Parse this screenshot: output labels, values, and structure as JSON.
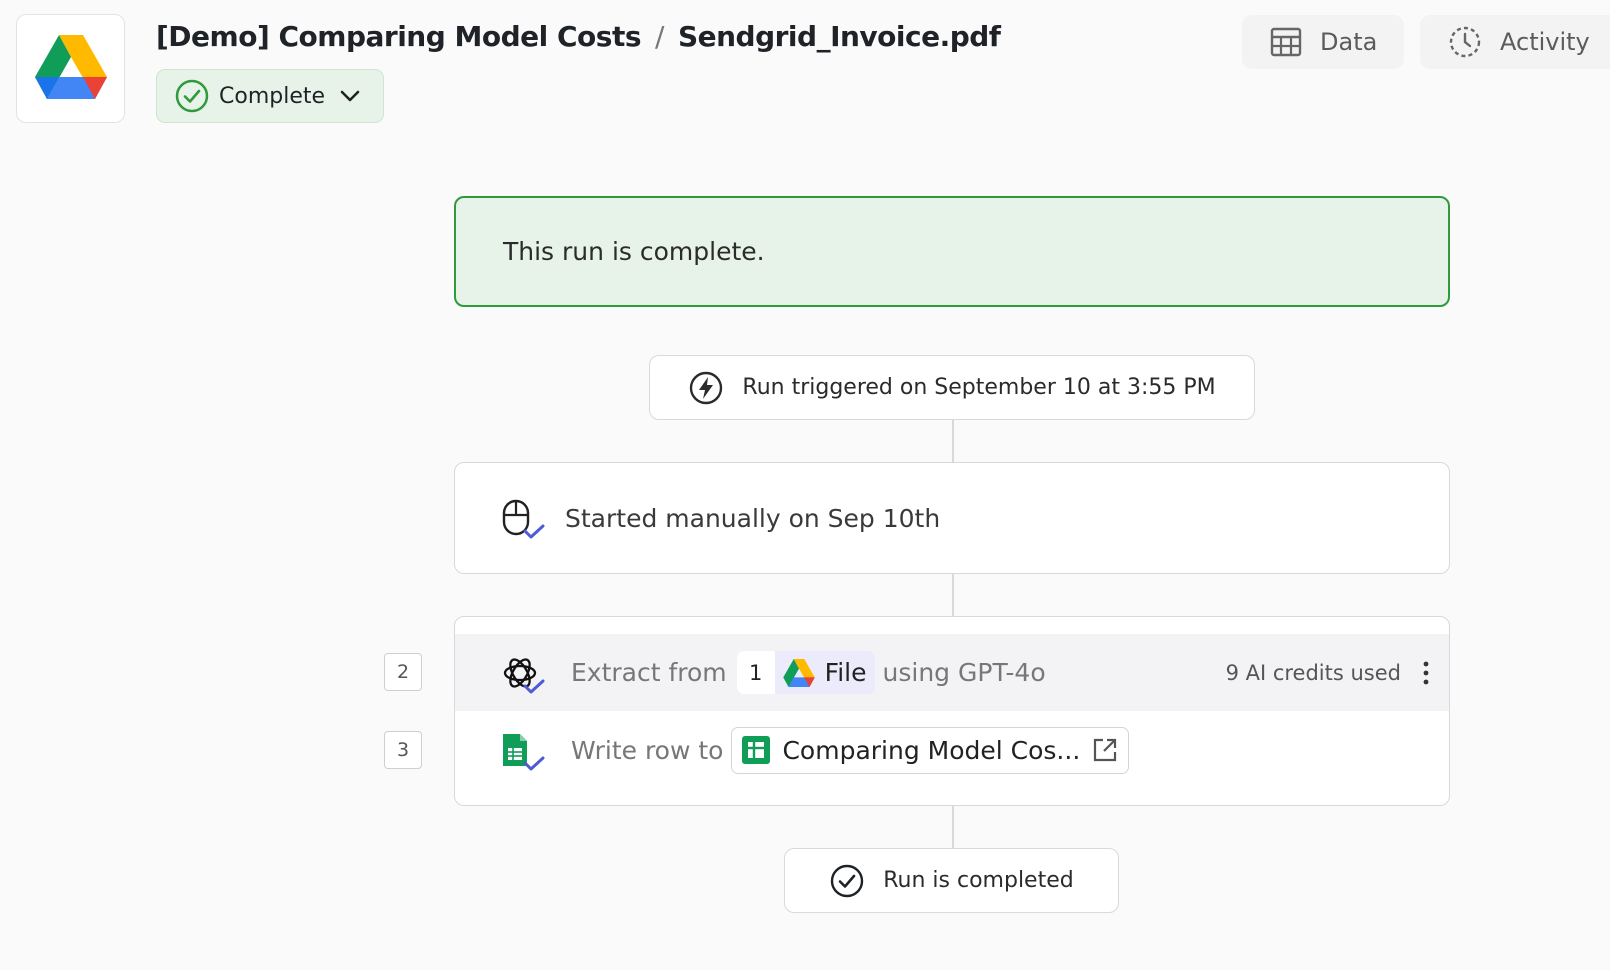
{
  "header": {
    "app_icon": "google-drive-icon",
    "folder": "[Demo] Comparing Model Costs",
    "separator": "/",
    "file": "Sendgrid_Invoice.pdf",
    "status": "Complete",
    "status_color": "#2f9a3c"
  },
  "toolbar": {
    "data_label": "Data",
    "activity_label": "Activity"
  },
  "banner": {
    "text": "This run is complete."
  },
  "trigger": {
    "text": "Run triggered on September 10 at 3:55 PM"
  },
  "steps": {
    "start": {
      "text": "Started manually on Sep 10th"
    },
    "extract": {
      "number": "2",
      "prefix": "Extract from",
      "var_count": "1",
      "var_label": "File",
      "suffix": "using GPT-4o",
      "credits": "9 AI credits used"
    },
    "write": {
      "number": "3",
      "prefix": "Write row to",
      "target": "Comparing Model Cos..."
    }
  },
  "footer": {
    "completed_text": "Run is completed"
  },
  "colors": {
    "success_bg": "#e7f3e8",
    "success_border": "#2f9a3c",
    "check_accent": "#4f5bd5"
  }
}
